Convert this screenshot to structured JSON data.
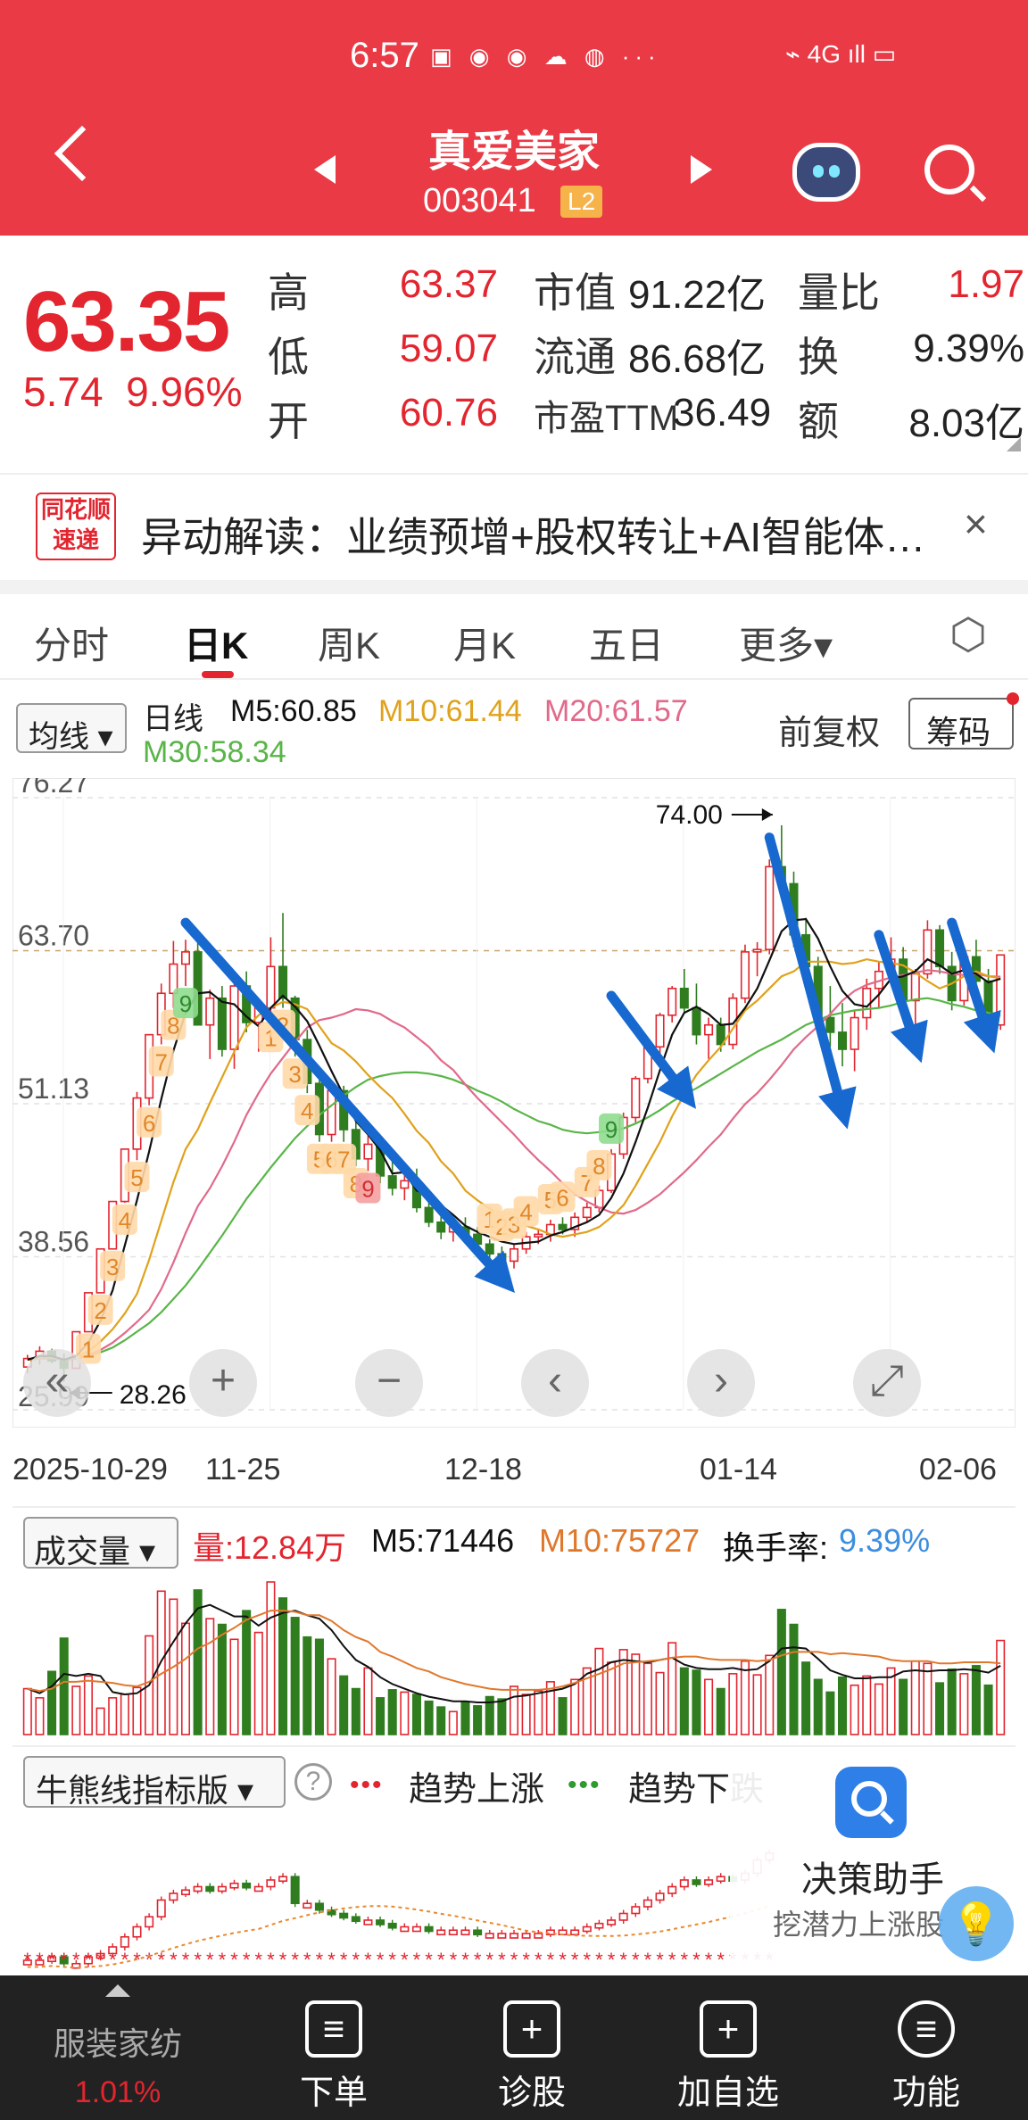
{
  "status_bar": {
    "time": "6:57",
    "icons": "▣ ◉ ◉ ☁ ◍ ···",
    "right": "⌁ 4G ıll ▭"
  },
  "header": {
    "stock_name": "真爱美家",
    "stock_code": "003041",
    "badge": "L2"
  },
  "quote": {
    "price": "63.35",
    "change": "5.74",
    "change_pct": "9.96%",
    "high_label": "高",
    "high": "63.37",
    "low_label": "低",
    "low": "59.07",
    "open_label": "开",
    "open": "60.76",
    "mktcap_label": "市值",
    "mktcap": "91.22亿",
    "float_label": "流通",
    "float": "86.68亿",
    "pe_label": "市盈TTM",
    "pe": "36.49",
    "vol_ratio_label": "量比",
    "vol_ratio": "1.97",
    "turnover_label": "换",
    "turnover": "9.39%",
    "amount_label": "额",
    "amount": "8.03亿"
  },
  "news": {
    "logo_line1": "同花顺",
    "logo_line2": "速递",
    "text": "异动解读：业绩预增+股权转让+AI智能体…",
    "close": "×"
  },
  "tabs": [
    "分时",
    "日K",
    "周K",
    "月K",
    "五日",
    "更多▾"
  ],
  "kline_bar": {
    "ma_select": "均线 ▾",
    "period": "日线",
    "m5": "M5:60.85",
    "m10": "M10:61.44",
    "m20": "M20:61.57",
    "m30": "M30:58.34",
    "fuquan": "前复权",
    "chouma": "筹码"
  },
  "chart_data": {
    "type": "candlestick",
    "y_ticks": [
      "76.27",
      "63.70",
      "51.13",
      "38.56",
      "25.99"
    ],
    "ylim": [
      25.99,
      76.27
    ],
    "x_ticks": [
      "2025-10-29",
      "11-25",
      "12-18",
      "01-14",
      "02-06"
    ],
    "annotations": {
      "high": "74.00",
      "low": "28.26"
    },
    "ohlc": [
      [
        29.5,
        30.5,
        29.0,
        30.2
      ],
      [
        30.2,
        31.2,
        29.7,
        30.8
      ],
      [
        30.8,
        31.0,
        29.8,
        30.0
      ],
      [
        30.0,
        30.6,
        28.3,
        29.4
      ],
      [
        29.4,
        32.4,
        29.4,
        32.4
      ],
      [
        32.4,
        35.6,
        32.4,
        35.6
      ],
      [
        35.6,
        39.2,
        35.6,
        39.2
      ],
      [
        39.2,
        43.1,
        39.2,
        43.1
      ],
      [
        43.1,
        47.4,
        43.0,
        47.4
      ],
      [
        47.4,
        52.1,
        46.5,
        51.6
      ],
      [
        51.6,
        56.8,
        51.0,
        56.8
      ],
      [
        56.8,
        61.0,
        56.0,
        60.2
      ],
      [
        60.2,
        64.5,
        59.0,
        62.6
      ],
      [
        62.6,
        64.6,
        60.8,
        63.6
      ],
      [
        63.6,
        65.0,
        57.6,
        57.6
      ],
      [
        57.6,
        60.5,
        54.8,
        59.8
      ],
      [
        59.8,
        60.8,
        55.0,
        55.6
      ],
      [
        55.6,
        61.6,
        54.0,
        60.8
      ],
      [
        60.8,
        62.0,
        57.0,
        57.8
      ],
      [
        57.8,
        59.6,
        55.4,
        59.0
      ],
      [
        59.0,
        64.8,
        58.0,
        62.4
      ],
      [
        62.4,
        66.8,
        59.0,
        59.8
      ],
      [
        59.8,
        60.0,
        55.0,
        56.4
      ],
      [
        56.4,
        57.2,
        52.0,
        52.8
      ],
      [
        52.8,
        54.0,
        48.0,
        48.6
      ],
      [
        48.6,
        52.8,
        48.0,
        52.2
      ],
      [
        52.2,
        52.6,
        48.0,
        49.0
      ],
      [
        49.0,
        50.4,
        46.0,
        46.6
      ],
      [
        46.6,
        48.8,
        45.6,
        47.8
      ],
      [
        47.8,
        48.2,
        44.6,
        45.2
      ],
      [
        45.2,
        46.4,
        43.6,
        44.2
      ],
      [
        44.2,
        45.8,
        43.2,
        44.8
      ],
      [
        44.8,
        45.8,
        42.2,
        42.6
      ],
      [
        42.6,
        43.6,
        41.0,
        41.4
      ],
      [
        41.4,
        42.4,
        40.0,
        40.6
      ],
      [
        40.6,
        41.6,
        39.8,
        41.0
      ],
      [
        41.0,
        41.8,
        40.2,
        40.4
      ],
      [
        40.4,
        41.0,
        39.2,
        39.6
      ],
      [
        39.6,
        40.0,
        38.4,
        38.8
      ],
      [
        38.8,
        39.4,
        37.8,
        38.2
      ],
      [
        38.2,
        39.6,
        37.6,
        39.2
      ],
      [
        39.2,
        40.6,
        38.8,
        40.2
      ],
      [
        40.2,
        40.8,
        39.6,
        40.4
      ],
      [
        40.4,
        41.6,
        39.8,
        41.2
      ],
      [
        41.2,
        41.8,
        40.4,
        40.8
      ],
      [
        40.8,
        42.2,
        40.2,
        41.8
      ],
      [
        41.8,
        43.0,
        41.4,
        42.6
      ],
      [
        42.6,
        44.4,
        42.2,
        44.0
      ],
      [
        44.0,
        47.4,
        43.8,
        47.0
      ],
      [
        47.0,
        50.4,
        46.6,
        50.0
      ],
      [
        50.0,
        53.4,
        49.6,
        53.2
      ],
      [
        53.2,
        56.2,
        52.8,
        55.8
      ],
      [
        55.8,
        58.6,
        55.2,
        58.4
      ],
      [
        58.4,
        60.8,
        57.8,
        60.6
      ],
      [
        60.6,
        62.2,
        58.6,
        59.0
      ],
      [
        59.0,
        61.0,
        56.0,
        56.8
      ],
      [
        56.8,
        58.2,
        54.8,
        57.6
      ],
      [
        57.6,
        58.2,
        55.4,
        56.0
      ],
      [
        56.0,
        60.2,
        55.6,
        59.8
      ],
      [
        59.8,
        64.2,
        59.4,
        63.6
      ],
      [
        63.6,
        64.4,
        61.6,
        63.8
      ],
      [
        63.8,
        71.2,
        63.4,
        70.6
      ],
      [
        70.6,
        74.0,
        68.4,
        69.2
      ],
      [
        69.2,
        70.2,
        64.0,
        65.0
      ],
      [
        65.0,
        66.4,
        61.6,
        62.4
      ],
      [
        62.4,
        63.2,
        57.4,
        58.2
      ],
      [
        58.2,
        60.8,
        55.8,
        57.0
      ],
      [
        57.0,
        59.4,
        54.2,
        55.6
      ],
      [
        55.6,
        58.8,
        53.8,
        58.2
      ],
      [
        58.2,
        61.4,
        57.2,
        60.6
      ],
      [
        60.6,
        62.8,
        59.0,
        62.0
      ],
      [
        62.0,
        64.8,
        61.4,
        63.0
      ],
      [
        63.0,
        64.0,
        58.6,
        59.6
      ],
      [
        59.6,
        62.2,
        57.6,
        61.8
      ],
      [
        61.8,
        66.2,
        61.4,
        65.4
      ],
      [
        65.4,
        65.8,
        61.8,
        62.4
      ],
      [
        62.4,
        63.6,
        58.8,
        59.6
      ],
      [
        59.6,
        63.8,
        59.2,
        63.2
      ],
      [
        63.2,
        64.6,
        60.4,
        61.2
      ],
      [
        61.2,
        62.2,
        57.6,
        57.6
      ],
      [
        57.6,
        63.37,
        57.2,
        63.35
      ]
    ],
    "ma": {
      "M5": [
        30.1,
        30.4,
        30.4,
        30.1,
        30.4,
        31.5,
        33.3,
        35.8,
        39.5,
        43.2,
        47.2,
        51.5,
        55.5,
        58.6,
        60.2,
        60.3,
        59.5,
        59.3,
        58.3,
        57.5,
        59.0,
        60.0,
        59.1,
        57.9,
        55.9,
        53.8,
        51.8,
        49.7,
        48.6,
        47.3,
        45.4,
        45.5,
        44.0,
        43.6,
        42.8,
        42.0,
        41.1,
        40.6,
        40.2,
        39.8,
        39.6,
        39.7,
        39.8,
        40.3,
        40.6,
        41.0,
        41.4,
        42.0,
        43.4,
        45.4,
        48.0,
        50.8,
        53.9,
        56.8,
        58.6,
        59.1,
        58.5,
        57.6,
        57.7,
        59.0,
        60.6,
        62.9,
        65.3,
        66.2,
        66.3,
        64.7,
        62.4,
        60.4,
        59.3,
        59.1,
        60.1,
        61.4,
        61.6,
        62.0,
        63.0,
        62.5,
        61.8,
        62.1,
        61.8,
        61.1,
        61.4
      ],
      "M10": [
        30.1,
        30.2,
        30.3,
        30.1,
        30.3,
        30.8,
        31.6,
        32.6,
        33.9,
        35.5,
        38.3,
        41.5,
        44.7,
        47.4,
        49.0,
        51.2,
        53.3,
        55.4,
        57.4,
        58.4,
        59.0,
        59.5,
        59.3,
        58.9,
        57.5,
        56.1,
        55.5,
        54.6,
        53.5,
        52.5,
        51.6,
        50.3,
        48.9,
        47.9,
        46.4,
        45.4,
        44.0,
        43.2,
        42.5,
        42.0,
        41.5,
        41.1,
        40.8,
        40.4,
        40.2,
        40.4,
        40.6,
        41.0,
        41.8,
        42.8,
        44.4,
        46.2,
        48.0,
        50.1,
        51.9,
        53.5,
        54.7,
        55.8,
        57.3,
        58.8,
        59.6,
        60.6,
        61.6,
        62.0,
        62.8,
        62.8,
        62.8,
        62.6,
        62.7,
        63.0,
        62.8,
        62.7,
        62.5,
        61.9,
        61.2,
        60.6,
        61.0,
        61.6,
        62.0,
        61.6,
        61.44
      ],
      "M20": [
        30.1,
        30.2,
        30.3,
        30.1,
        30.2,
        30.5,
        30.9,
        31.5,
        32.3,
        33.2,
        34.2,
        35.9,
        38.1,
        40.5,
        42.7,
        44.2,
        46.0,
        48.0,
        50.2,
        52.0,
        53.6,
        54.9,
        56.2,
        57.4,
        58.0,
        58.2,
        58.5,
        58.9,
        58.8,
        58.5,
        57.9,
        57.4,
        56.6,
        55.8,
        54.7,
        53.9,
        52.7,
        51.6,
        50.6,
        49.6,
        48.6,
        47.5,
        46.5,
        45.6,
        44.6,
        43.7,
        43.1,
        42.6,
        42.2,
        42.1,
        42.4,
        43.0,
        43.7,
        44.6,
        45.5,
        46.5,
        47.6,
        48.6,
        49.9,
        51.1,
        52.0,
        53.1,
        54.3,
        55.6,
        56.6,
        57.5,
        58.5,
        59.6,
        60.4,
        60.9,
        61.2,
        61.5,
        61.7,
        61.9,
        62.1,
        62.0,
        61.8,
        61.7,
        61.8,
        61.6,
        61.57
      ],
      "M30": [
        30.1,
        30.2,
        30.2,
        30.1,
        30.2,
        30.4,
        30.7,
        31.1,
        31.7,
        32.4,
        33.1,
        34.0,
        35.1,
        36.2,
        37.5,
        38.9,
        40.3,
        41.8,
        43.3,
        44.6,
        45.9,
        47.1,
        48.3,
        49.3,
        50.2,
        51.0,
        51.8,
        52.5,
        53.1,
        53.4,
        53.6,
        53.7,
        53.7,
        53.6,
        53.4,
        53.1,
        52.7,
        52.2,
        51.8,
        51.3,
        50.7,
        50.2,
        49.7,
        49.4,
        49.0,
        48.8,
        48.7,
        48.8,
        48.9,
        49.1,
        49.5,
        50.0,
        50.6,
        51.3,
        51.9,
        52.4,
        53.0,
        53.6,
        54.2,
        54.8,
        55.4,
        55.9,
        56.4,
        57.0,
        57.6,
        58.0,
        58.4,
        58.6,
        58.8,
        58.9,
        59.0,
        59.2,
        59.5,
        59.7,
        59.8,
        59.6,
        59.3,
        59.1,
        58.8,
        58.6,
        58.34
      ]
    },
    "td_labels": [
      {
        "label": "1",
        "i": 5,
        "pos": "below"
      },
      {
        "label": "2",
        "i": 6,
        "pos": "below"
      },
      {
        "label": "3",
        "i": 7,
        "pos": "below"
      },
      {
        "label": "4",
        "i": 8,
        "pos": "below"
      },
      {
        "label": "5",
        "i": 9,
        "pos": "below"
      },
      {
        "label": "6",
        "i": 10,
        "pos": "below"
      },
      {
        "label": "7",
        "i": 11,
        "pos": "below"
      },
      {
        "label": "8",
        "i": 12,
        "pos": "below"
      },
      {
        "label": "9",
        "i": 13,
        "pos": "below"
      },
      {
        "label": "1",
        "i": 20,
        "pos": "below"
      },
      {
        "label": "2",
        "i": 21,
        "pos": "below"
      },
      {
        "label": "3",
        "i": 22,
        "pos": "below"
      },
      {
        "label": "4",
        "i": 23,
        "pos": "below"
      },
      {
        "label": "5",
        "i": 24,
        "pos": "below"
      },
      {
        "label": "6",
        "i": 25,
        "pos": "below"
      },
      {
        "label": "7",
        "i": 26,
        "pos": "below"
      },
      {
        "label": "8",
        "i": 27,
        "pos": "below"
      },
      {
        "label": "9",
        "i": 28,
        "pos": "below"
      },
      {
        "label": "1",
        "i": 38,
        "pos": "above"
      },
      {
        "label": "2",
        "i": 39,
        "pos": "above"
      },
      {
        "label": "3",
        "i": 40,
        "pos": "above"
      },
      {
        "label": "4",
        "i": 41,
        "pos": "above"
      },
      {
        "label": "5",
        "i": 43,
        "pos": "above"
      },
      {
        "label": "6",
        "i": 44,
        "pos": "above"
      },
      {
        "label": "7",
        "i": 46,
        "pos": "above"
      },
      {
        "label": "8",
        "i": 47,
        "pos": "above"
      },
      {
        "label": "9",
        "i": 48,
        "pos": "above"
      }
    ],
    "arrows": [
      {
        "from": [
          13,
          66.0
        ],
        "to": [
          39,
          36.8
        ]
      },
      {
        "from": [
          48,
          60.0
        ],
        "to": [
          54,
          52.0
        ]
      },
      {
        "from": [
          61,
          73.0
        ],
        "to": [
          67,
          50.6
        ]
      },
      {
        "from": [
          70,
          65.0
        ],
        "to": [
          73,
          56.0
        ]
      },
      {
        "from": [
          76,
          66.0
        ],
        "to": [
          79,
          56.8
        ]
      }
    ],
    "colors": {
      "up": "#e2252f",
      "down": "#2f7d1e",
      "m5": "#111111",
      "m10": "#e0a21c",
      "m20": "#e06a8a",
      "m30": "#59b548",
      "arrow": "#1769d0"
    }
  },
  "chart_controls": [
    "«",
    "+",
    "−",
    "‹",
    "›",
    "⤢"
  ],
  "volume": {
    "select": "成交量 ▾",
    "vol": "量:12.84万",
    "m5": "M5:71446",
    "m10": "M10:75727",
    "turnover_label": "换手率:",
    "turnover": "9.39%",
    "values": [
      4.0,
      3.2,
      5.5,
      8.4,
      4.2,
      5.1,
      2.3,
      3.2,
      3.5,
      4.1,
      8.6,
      12.5,
      11.8,
      9.7,
      12.6,
      10.1,
      9.6,
      8.3,
      10.8,
      8.9,
      13.3,
      11.9,
      10.2,
      8.5,
      8.3,
      6.6,
      5.1,
      4.0,
      5.8,
      3.2,
      3.9,
      3.7,
      3.5,
      2.9,
      2.4,
      2.0,
      2.8,
      2.5,
      3.3,
      3.1,
      4.2,
      3.5,
      3.8,
      4.6,
      3.2,
      4.8,
      5.8,
      7.5,
      6.3,
      7.4,
      7.0,
      6.2,
      5.4,
      8.0,
      5.8,
      5.6,
      4.8,
      4.0,
      5.3,
      6.4,
      5.2,
      6.9,
      10.9,
      9.6,
      6.3,
      4.8,
      3.7,
      5.0,
      4.3,
      5.1,
      4.4,
      5.8,
      4.8,
      6.4,
      6.2,
      4.5,
      5.7,
      5.3,
      6.0,
      4.3,
      8.2
    ],
    "ma5": [
      4.0,
      3.6,
      4.2,
      5.3,
      5.1,
      5.3,
      5.1,
      3.7,
      3.5,
      3.6,
      4.3,
      6.4,
      8.1,
      9.7,
      11.0,
      11.3,
      10.8,
      10.3,
      10.3,
      9.5,
      10.2,
      10.6,
      10.8,
      10.4,
      10.1,
      9.1,
      7.7,
      6.5,
      5.9,
      5.0,
      4.4,
      4.0,
      3.6,
      3.3,
      3.1,
      2.9,
      2.9,
      2.8,
      2.8,
      2.9,
      3.3,
      3.4,
      3.6,
      3.8,
      4.0,
      4.4,
      5.3,
      5.7,
      6.3,
      6.5,
      6.4,
      6.3,
      6.5,
      6.7,
      6.1,
      5.8,
      5.7,
      5.7,
      5.8,
      5.6,
      5.7,
      6.4,
      7.5,
      7.6,
      7.5,
      6.6,
      5.6,
      5.2,
      4.9,
      4.9,
      5.0,
      5.0,
      5.5,
      5.6,
      5.5,
      5.6,
      5.6,
      5.7,
      5.6,
      5.4,
      6.0
    ],
    "ma10": [
      4.0,
      3.8,
      4.0,
      4.6,
      4.6,
      4.7,
      4.6,
      4.5,
      4.3,
      4.2,
      4.6,
      5.3,
      5.9,
      6.6,
      7.5,
      8.0,
      8.7,
      9.3,
      10.0,
      10.4,
      10.8,
      10.8,
      10.7,
      10.4,
      10.4,
      9.9,
      9.1,
      8.5,
      8.1,
      7.2,
      6.8,
      6.3,
      5.8,
      5.5,
      5.0,
      4.7,
      4.4,
      4.2,
      4.0,
      3.9,
      3.9,
      3.9,
      3.9,
      4.0,
      4.2,
      4.5,
      4.9,
      5.3,
      5.7,
      6.2,
      6.3,
      6.4,
      6.5,
      6.7,
      6.8,
      6.8,
      6.6,
      6.5,
      6.5,
      6.5,
      6.4,
      6.5,
      6.9,
      7.2,
      7.2,
      7.2,
      7.0,
      7.1,
      7.0,
      6.9,
      6.8,
      6.5,
      6.4,
      6.4,
      6.4,
      6.2,
      6.2,
      6.3,
      6.3,
      6.3,
      6.2
    ]
  },
  "indicator": {
    "select": "牛熊线指标版 ▾",
    "help": "?",
    "legend_up": "趋势上涨",
    "legend_down": "趋势下跌",
    "assistant_title": "决策助手",
    "assistant_sub": "挖潜力上涨股",
    "values": [
      44,
      44,
      45,
      43,
      43,
      45,
      46,
      48,
      51,
      54,
      57,
      62,
      64,
      65,
      66,
      65,
      66,
      67,
      66,
      66,
      68,
      69,
      61,
      61,
      59,
      58,
      57,
      56,
      56,
      55,
      54,
      54,
      54,
      53,
      53,
      53,
      53,
      52,
      52,
      52,
      52,
      52,
      52,
      53,
      53,
      53,
      54,
      55,
      56,
      58,
      60,
      62,
      64,
      66,
      68,
      67,
      68,
      69,
      68,
      70,
      74,
      76
    ]
  },
  "bottom_nav": {
    "sector": "服装家纺",
    "sector_pct": "1.01%",
    "items": [
      "下单",
      "诊股",
      "加自选",
      "功能"
    ]
  }
}
